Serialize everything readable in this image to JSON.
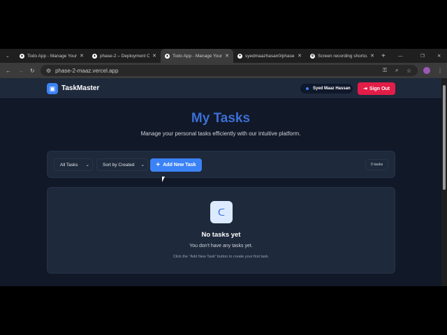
{
  "browser": {
    "tabs": [
      {
        "title": "Todo App - Manage Your",
        "active": false
      },
      {
        "title": "phase-2 – Deployment O",
        "active": false
      },
      {
        "title": "Todo App - Manage Your",
        "active": true
      },
      {
        "title": "syedmaazhasan0/phase-",
        "active": false
      },
      {
        "title": "Screen recording shortcu",
        "active": false
      }
    ],
    "url": "phase-2-maaz.vercel.app"
  },
  "nav": {
    "brand": "TaskMaster",
    "user": "Syed Maaz Hassan",
    "sign_out": "Sign Out"
  },
  "main": {
    "title": "My Tasks",
    "subtitle": "Manage your personal tasks efficiently with our intuitive platform.",
    "filter": "All Tasks",
    "sort": "Sort by Created",
    "add_button": "Add New Task",
    "count": "0 tasks"
  },
  "empty": {
    "title": "No tasks yet",
    "message": "You don't have any tasks yet.",
    "hint": "Click the \"Add New Task\" button to create your first task."
  },
  "colors": {
    "accent": "#3b82f6",
    "danger": "#e11d48",
    "bg": "#111827",
    "card": "#1e293b"
  }
}
